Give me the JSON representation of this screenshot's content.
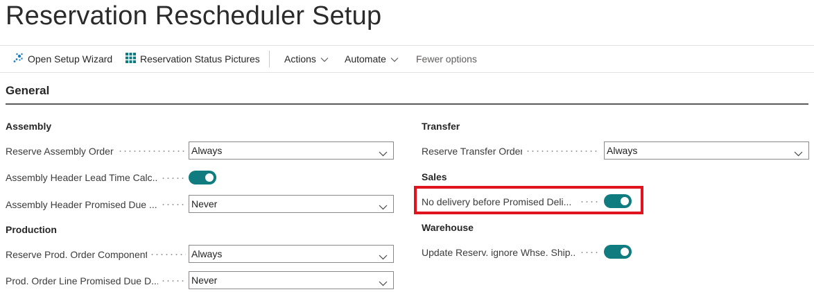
{
  "page": {
    "title": "Reservation Rescheduler Setup"
  },
  "actions": {
    "open_setup_wizard": "Open Setup Wizard",
    "reservation_status_pictures": "Reservation Status Pictures",
    "actions_menu": "Actions",
    "automate_menu": "Automate",
    "fewer_options": "Fewer options"
  },
  "general": {
    "title": "General",
    "assembly": {
      "heading": "Assembly",
      "reserve_assembly_order": {
        "label": "Reserve Assembly Order",
        "value": "Always"
      },
      "header_lead_time": {
        "label": "Assembly Header Lead Time Calc...",
        "on": true
      },
      "header_promised_due": {
        "label": "Assembly Header Promised Due ...",
        "value": "Never"
      }
    },
    "production": {
      "heading": "Production",
      "reserve_prod_component": {
        "label": "Reserve Prod. Order Component",
        "value": "Always"
      },
      "line_promised_due": {
        "label": "Prod. Order Line Promised Due D...",
        "value": "Never"
      }
    },
    "transfer": {
      "heading": "Transfer",
      "reserve_transfer_order": {
        "label": "Reserve Transfer Order",
        "value": "Always"
      }
    },
    "sales": {
      "heading": "Sales",
      "no_delivery_before_promised": {
        "label": "No delivery before Promised Deli...",
        "on": true
      }
    },
    "warehouse": {
      "heading": "Warehouse",
      "update_reserv_ignore_whse": {
        "label": "Update Reserv. ignore Whse. Ship...",
        "on": true
      }
    }
  },
  "colors": {
    "accent_toggle": "#107c7f",
    "highlight": "#e0141e"
  }
}
